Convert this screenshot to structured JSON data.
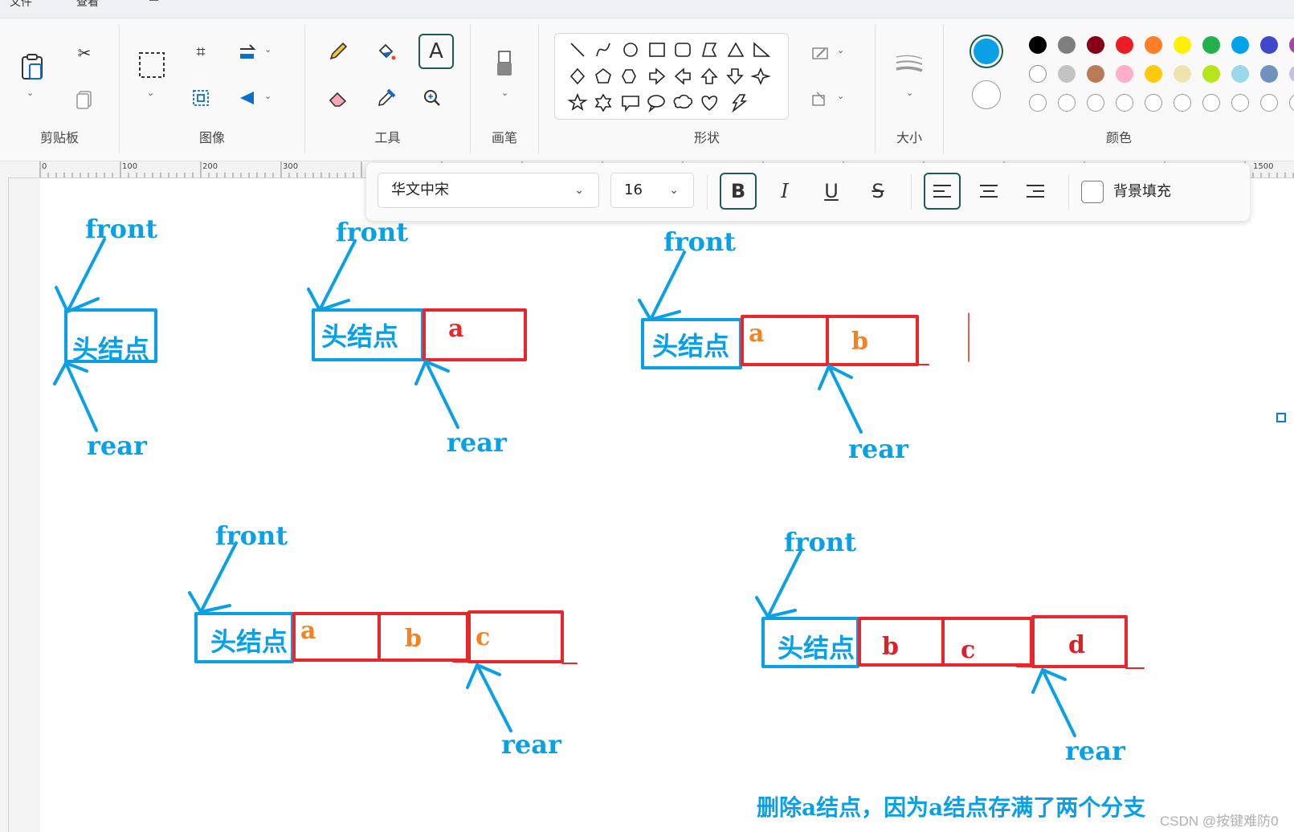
{
  "menu": {
    "file": "文件",
    "view": "查看"
  },
  "ribbon": {
    "clipboard_label": "剪贴板",
    "image_label": "图像",
    "tools_label": "工具",
    "brush_label": "画笔",
    "shapes_label": "形状",
    "size_label": "大小",
    "colors_label": "颜色",
    "text_tool_glyph": "A"
  },
  "colors": {
    "primary": "#0aa0e6",
    "secondary": "#ffffff",
    "row1": [
      "#000000",
      "#7f7f7f",
      "#880015",
      "#ed1c24",
      "#ff7f27",
      "#fff200",
      "#22b14c",
      "#00a2e8",
      "#3f48cc",
      "#a349a4"
    ],
    "row2": [
      "#ffffff",
      "#c3c3c3",
      "#b97a57",
      "#ffaec9",
      "#ffc90e",
      "#efe4b0",
      "#b5e61d",
      "#99d9ea",
      "#7092be",
      "#c8bfe7"
    ]
  },
  "ruler": {
    "t0": "0",
    "t100": "100",
    "t200": "200",
    "t300": "300",
    "t1500": "1500"
  },
  "textbar": {
    "font_name": "华文中宋",
    "font_size": "16",
    "bold": "B",
    "italic": "I",
    "underline": "U",
    "strike": "S",
    "bg_fill_label": "背景填充"
  },
  "drawing": {
    "front": "front",
    "rear": "rear",
    "head": "头结点",
    "a": "a",
    "b": "b",
    "c": "c",
    "d": "d",
    "caption": "删除a结点，因为a结点存满了两个分支",
    "watermark": "CSDN @按键难防0"
  }
}
